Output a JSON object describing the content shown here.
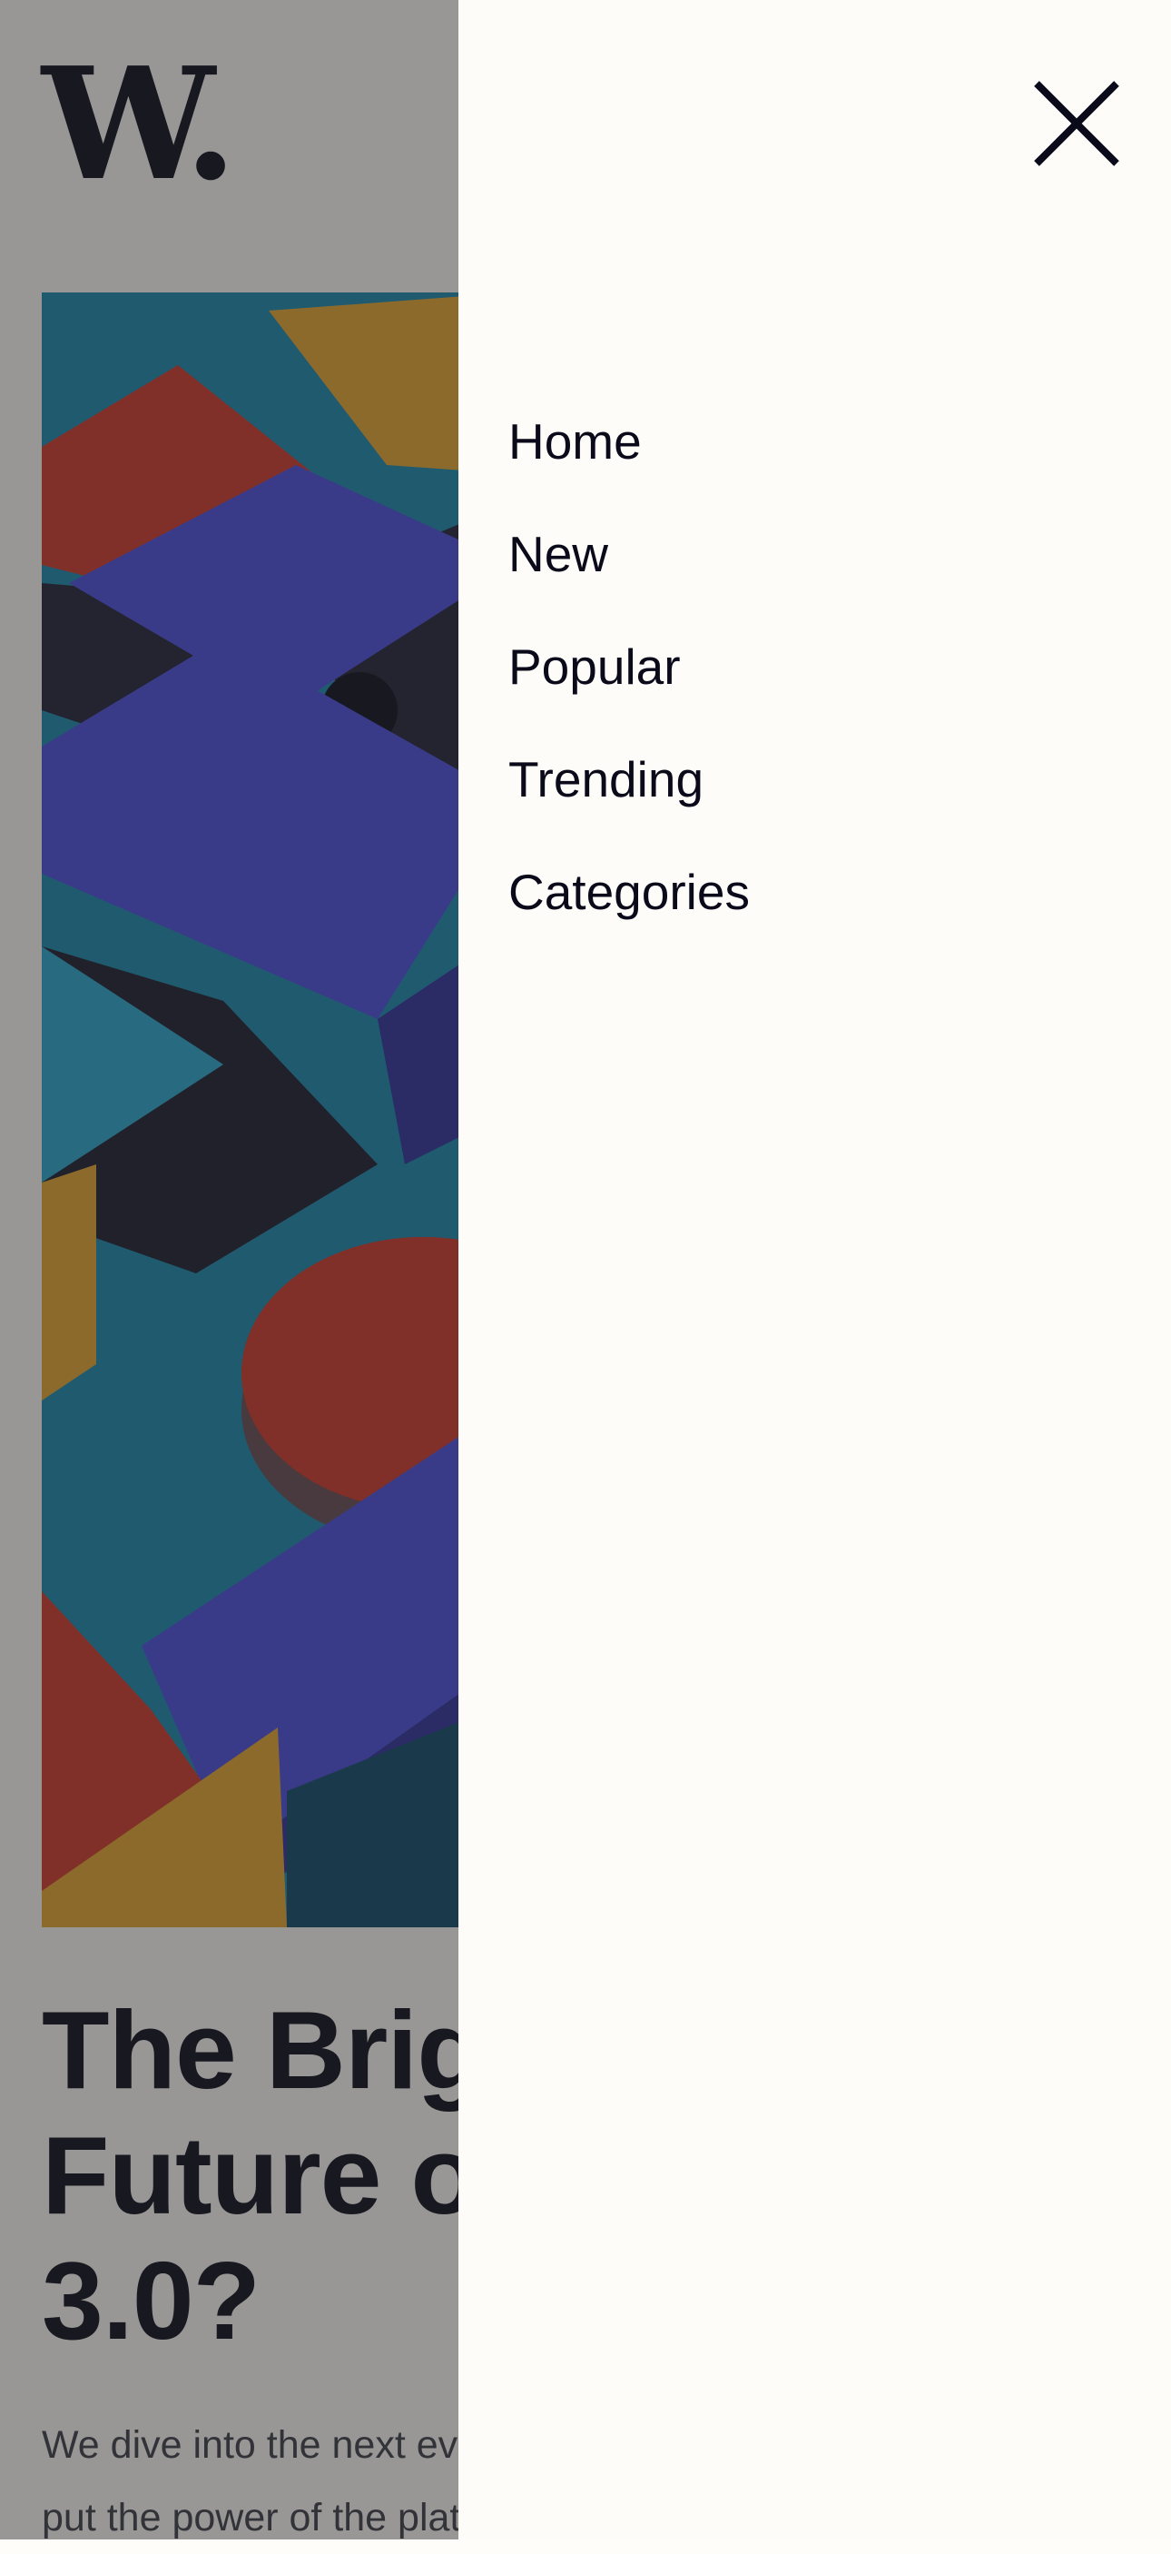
{
  "page": {
    "logo_text": "W.",
    "article": {
      "headline_lines": [
        "The Bright",
        "Future of Web",
        "3.0?"
      ],
      "excerpt_lines": [
        "We dive into the next evolution of the web that claims to",
        "put the power of the platforms back in the hands of users"
      ]
    }
  },
  "drawer": {
    "close_icon": "close-icon",
    "nav": [
      "Home",
      "New",
      "Popular",
      "Trending",
      "Categories"
    ]
  },
  "colors": {
    "ink": "#0a0a1a",
    "drawer_bg": "#fdfcf8",
    "overlay": "rgba(40,40,40,0.48)"
  }
}
